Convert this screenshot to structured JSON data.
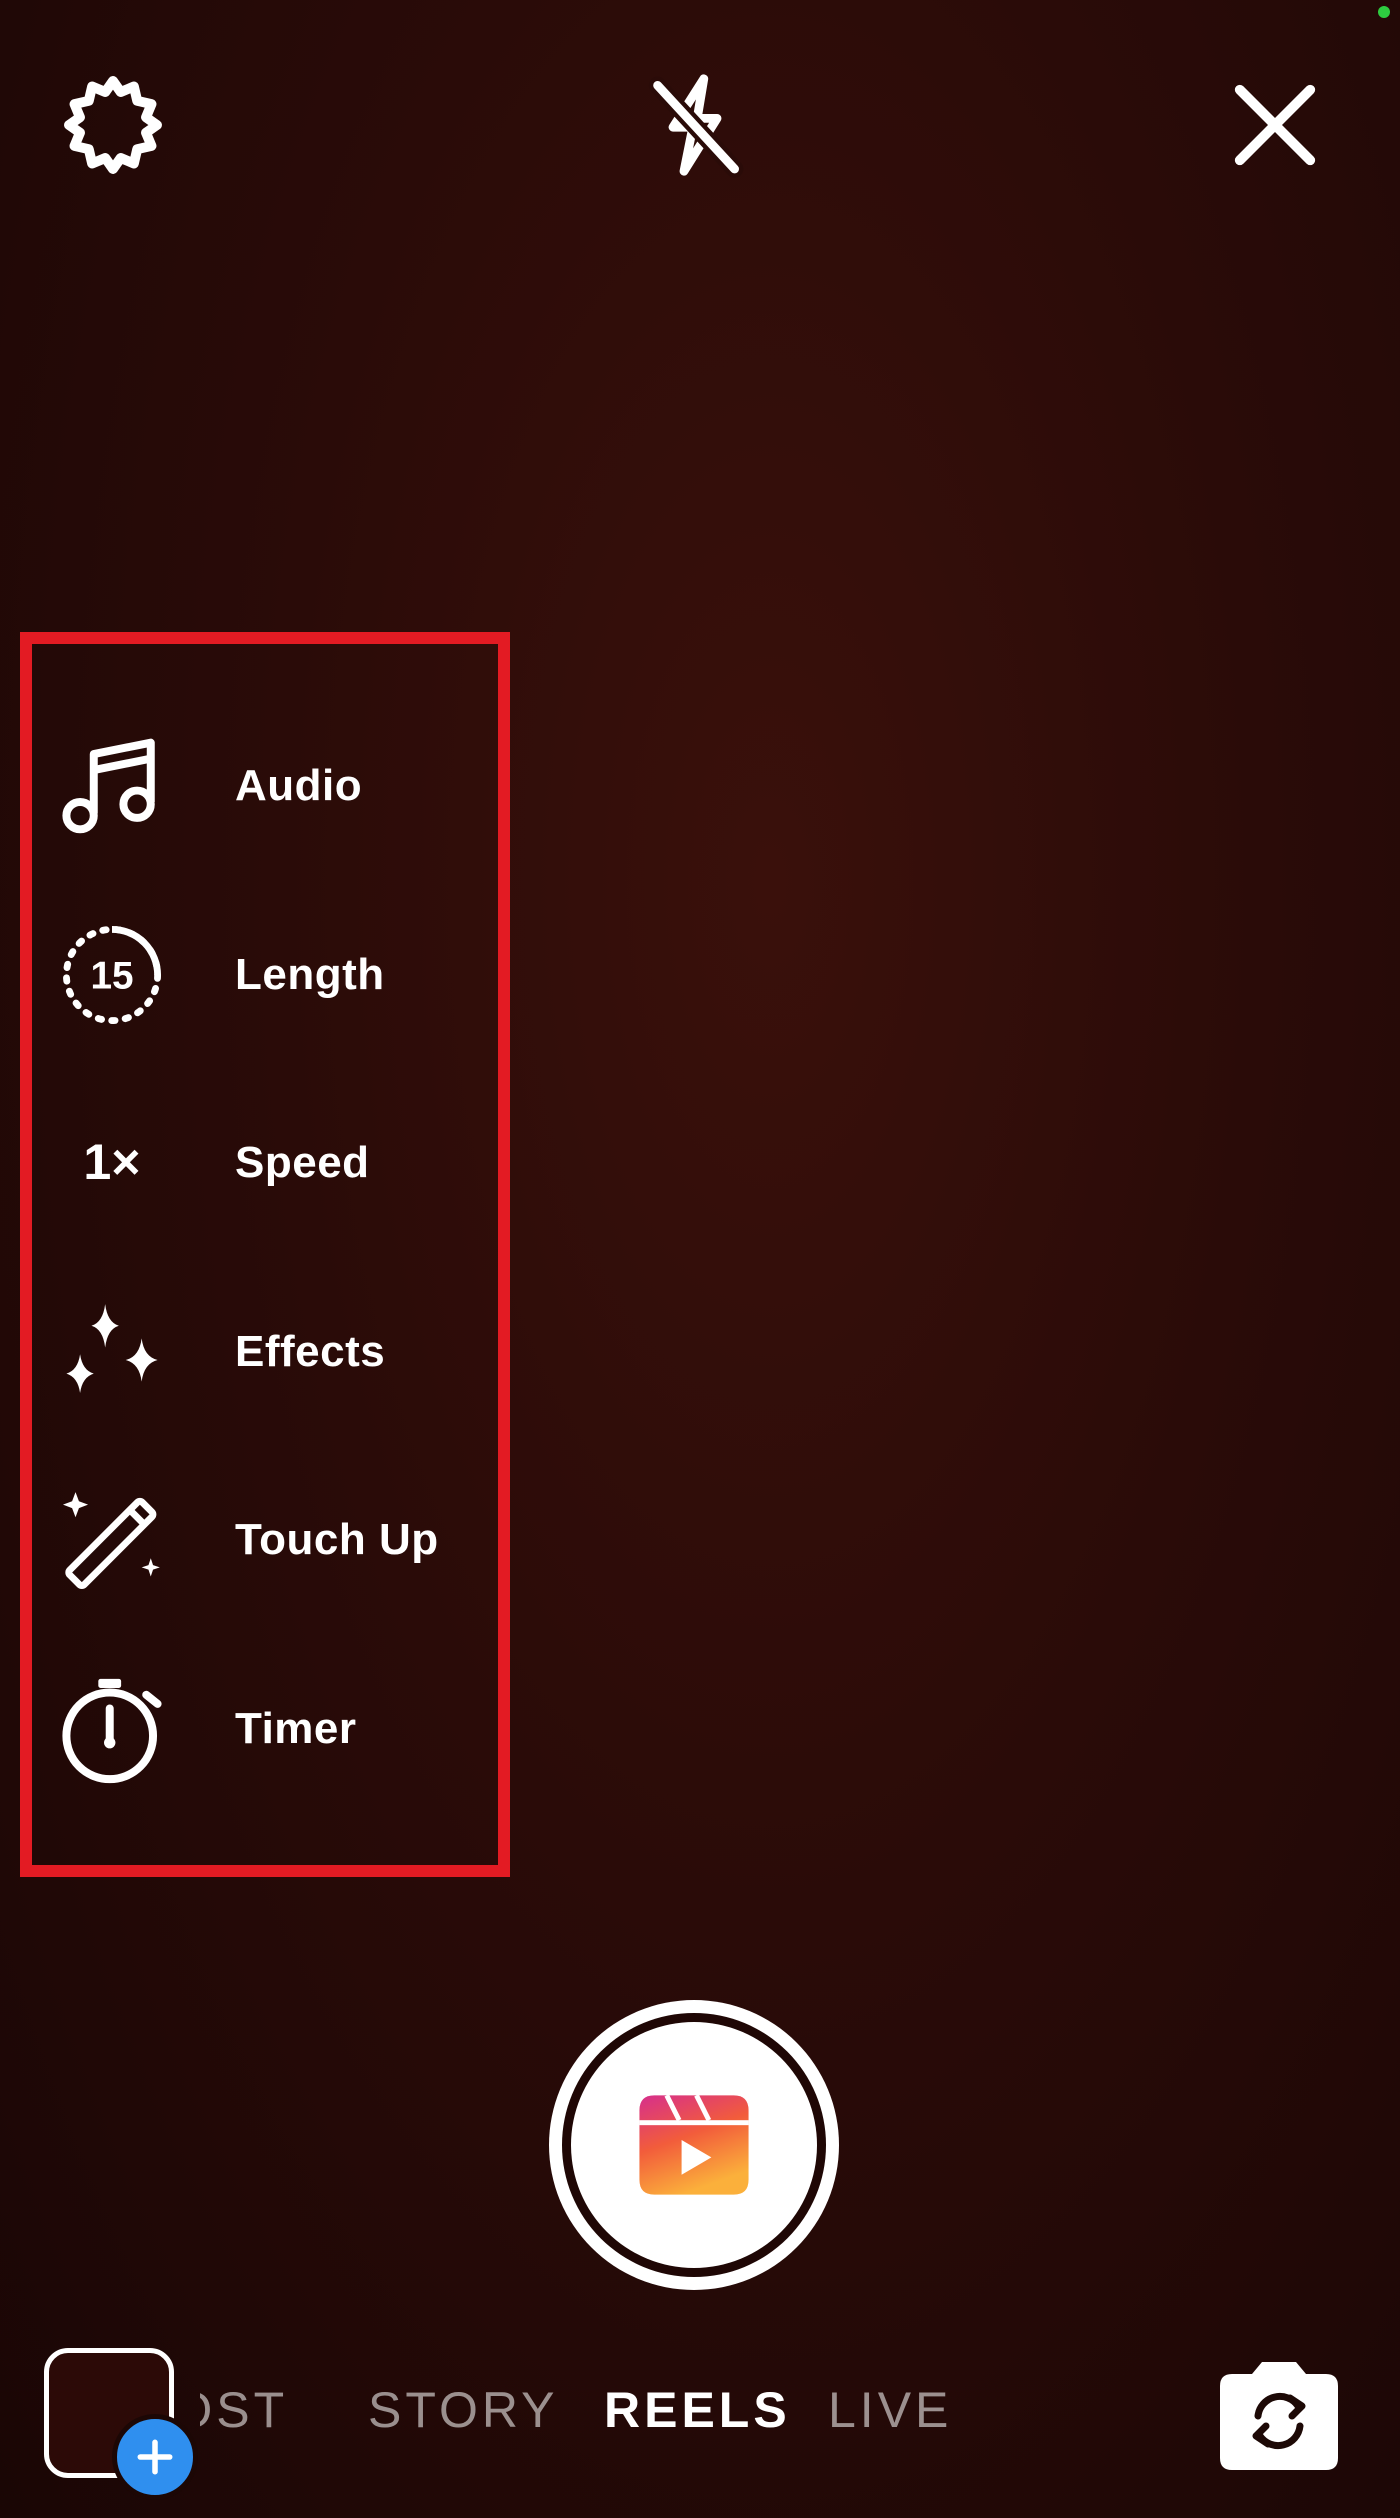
{
  "colors": {
    "highlight_box": "#e31b23",
    "status_dot": "#2ecc40",
    "plus_badge": "#2f8fef",
    "reels_gradient": [
      "#d62f8c",
      "#f25c3b",
      "#fbb03b"
    ]
  },
  "top_bar": {
    "settings_icon": "gear-icon",
    "flash_icon": "flash-off-icon",
    "close_icon": "close-icon"
  },
  "tools": [
    {
      "label": "Audio",
      "icon": "music-note-icon"
    },
    {
      "label": "Length",
      "icon": "timer-15-icon",
      "icon_text": "15"
    },
    {
      "label": "Speed",
      "icon": "speed-icon",
      "icon_text": "1×"
    },
    {
      "label": "Effects",
      "icon": "sparkles-icon"
    },
    {
      "label": "Touch Up",
      "icon": "magic-wand-icon"
    },
    {
      "label": "Timer",
      "icon": "stopwatch-icon"
    }
  ],
  "capture": {
    "shutter_icon": "reels-icon"
  },
  "modes": {
    "items": [
      "POST",
      "STORY",
      "REELS",
      "LIVE"
    ],
    "selected": "REELS"
  },
  "bottom_bar": {
    "gallery_icon": "gallery-thumbnail",
    "plus_icon": "plus-icon",
    "flip_icon": "flip-camera-icon"
  }
}
